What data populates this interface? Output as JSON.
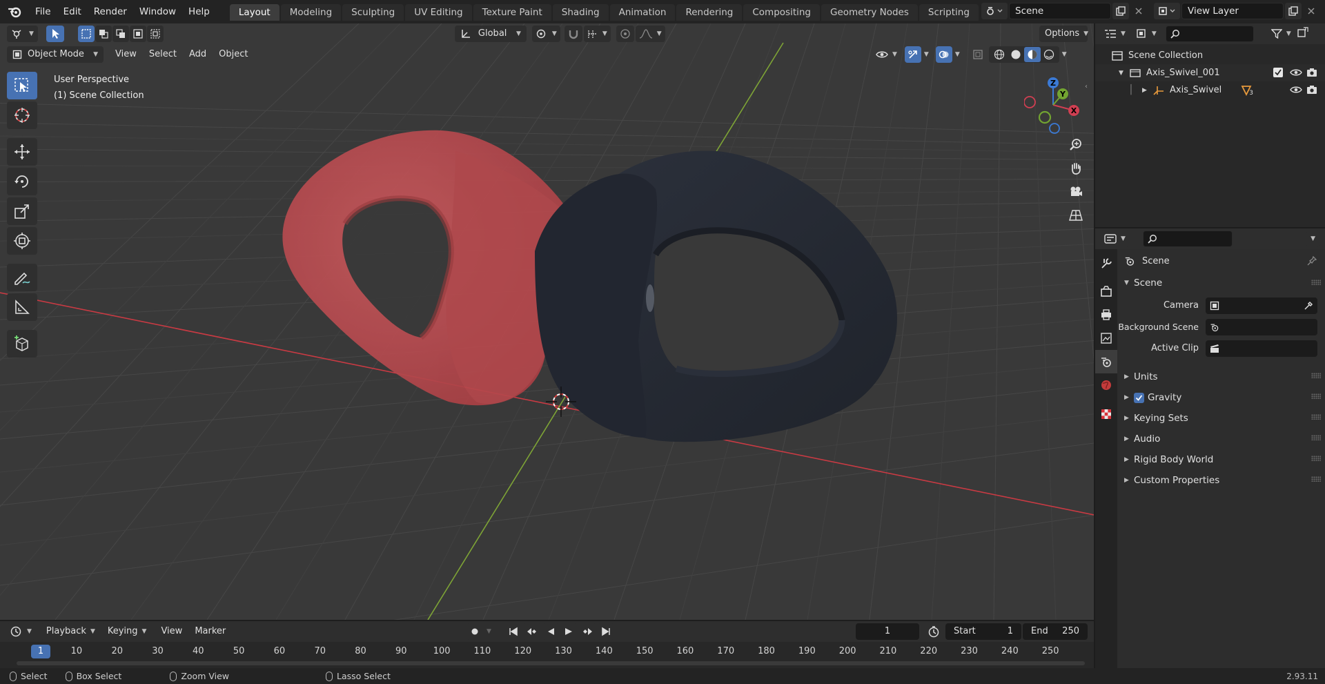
{
  "topbar": {
    "menus": [
      "File",
      "Edit",
      "Render",
      "Window",
      "Help"
    ],
    "workspaces": [
      "Layout",
      "Modeling",
      "Sculpting",
      "UV Editing",
      "Texture Paint",
      "Shading",
      "Animation",
      "Rendering",
      "Compositing",
      "Geometry Nodes",
      "Scripting"
    ],
    "active_workspace": "Layout",
    "scene_name": "Scene",
    "view_layer": "View Layer"
  },
  "viewport": {
    "mode": "Object Mode",
    "menus": [
      "View",
      "Select",
      "Add",
      "Object"
    ],
    "orientation": "Global",
    "options_label": "Options",
    "overlay_title": "User Perspective",
    "overlay_collection": "(1) Scene Collection",
    "gizmo_axes": {
      "x": "X",
      "y": "Y",
      "z": "Z"
    },
    "colors": {
      "background": "#393939",
      "x_axis": "#c93a43",
      "y_axis": "#7ea436",
      "red_object": "#b84a4e",
      "dark_object": "#262a33"
    }
  },
  "outliner": {
    "root": "Scene Collection",
    "collection": "Axis_Swivel_001",
    "object": "Axis_Swivel",
    "object_badge": "3"
  },
  "properties": {
    "context": "Scene",
    "section": "Scene",
    "rows": [
      {
        "label": "Camera",
        "value": ""
      },
      {
        "label": "Background Scene",
        "value": ""
      },
      {
        "label": "Active Clip",
        "value": ""
      }
    ],
    "collapsed_sections": [
      "Units",
      "Gravity",
      "Keying Sets",
      "Audio",
      "Rigid Body World",
      "Custom Properties"
    ],
    "gravity_checked": true
  },
  "timeline": {
    "menus": [
      "Playback",
      "Keying",
      "View",
      "Marker"
    ],
    "current_frame": "1",
    "start_label": "Start",
    "start": "1",
    "end_label": "End",
    "end": "250",
    "ruler": [
      "10",
      "20",
      "30",
      "40",
      "50",
      "60",
      "70",
      "80",
      "90",
      "100",
      "110",
      "120",
      "130",
      "140",
      "150",
      "160",
      "170",
      "180",
      "190",
      "200",
      "210",
      "220",
      "230",
      "240",
      "250"
    ],
    "ruler_current": "1"
  },
  "status": {
    "select": "Select",
    "box_select": "Box Select",
    "zoom_view": "Zoom View",
    "lasso_select": "Lasso Select",
    "version": "2.93.11"
  }
}
